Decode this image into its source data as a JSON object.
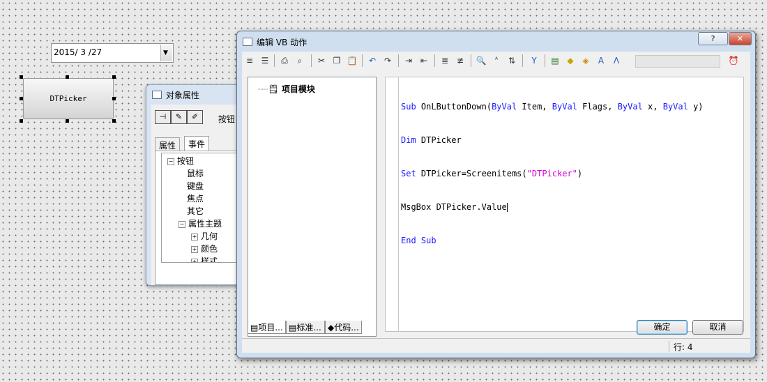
{
  "canvas": {
    "date_picker": {
      "value": "2015/ 3 /27",
      "dropdown_icon": "chevron-down-icon"
    },
    "button": {
      "label": "DTPicker"
    }
  },
  "object_properties": {
    "title": "对象属性",
    "object_type": "按钮",
    "tabs": [
      "属性",
      "事件"
    ],
    "active_tab": "事件",
    "tree": {
      "root": "按钮",
      "children": [
        "鼠标",
        "键盘",
        "焦点",
        "其它"
      ],
      "group": "属性主题",
      "group_children": [
        "几何",
        "颜色",
        "样式"
      ]
    }
  },
  "vb_editor": {
    "title": "编辑 VB 动作",
    "help_label": "?",
    "close_label": "✕",
    "project_root": "项目模块",
    "bottom_tabs": [
      "项目...",
      "标准...",
      "代码..."
    ],
    "code_lines": [
      {
        "kw1": "Sub",
        "t1": " OnLButtonDown(",
        "kw2": "ByVal",
        "t2": " Item, ",
        "kw3": "ByVal",
        "t3": " Flags, ",
        "kw4": "ByVal",
        "t4": " x, ",
        "kw5": "ByVal",
        "t5": " y)"
      },
      {
        "kw1": "Dim",
        "t1": " DTPicker"
      },
      {
        "kw1": "Set",
        "t1": " DTPicker=Screenitems(",
        "str": "\"DTPicker\"",
        "t2": ")"
      },
      {
        "t1": "MsgBox DTPicker.Value"
      },
      {
        "kw1": "End",
        "t1": " ",
        "kw2": "Sub"
      }
    ],
    "ok_label": "确定",
    "cancel_label": "取消",
    "status_line": "行: 4"
  }
}
